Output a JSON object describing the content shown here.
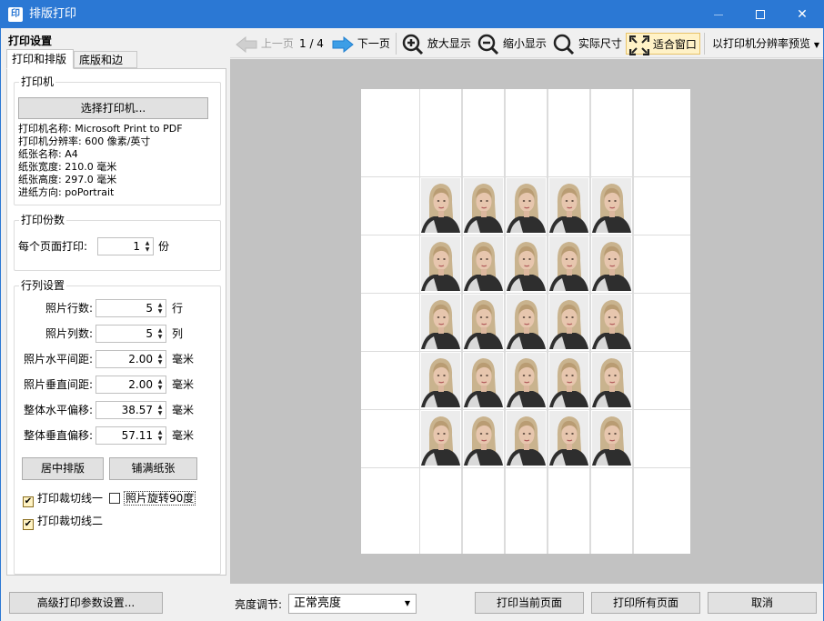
{
  "window": {
    "title": "排版打印",
    "app_icon": "印"
  },
  "left": {
    "header": "打印设置",
    "tabs": [
      {
        "label": "打印和排版"
      },
      {
        "label": "底版和边框"
      }
    ],
    "printer_group": {
      "title": "打印机",
      "select_button": "选择打印机...",
      "info": [
        "打印机名称: Microsoft Print to PDF",
        "打印机分辨率: 600 像素/英寸",
        "纸张名称: A4",
        "纸张宽度: 210.0 毫米",
        "纸张高度: 297.0 毫米",
        "进纸方向: poPortrait"
      ]
    },
    "copies_group": {
      "title": "打印份数",
      "label": "每个页面打印:",
      "value": "1",
      "unit": "份"
    },
    "layout_group": {
      "title": "行列设置",
      "fields": [
        {
          "label": "照片行数:",
          "value": "5",
          "unit": "行"
        },
        {
          "label": "照片列数:",
          "value": "5",
          "unit": "列"
        },
        {
          "label": "照片水平间距:",
          "value": "2.00",
          "unit": "毫米"
        },
        {
          "label": "照片垂直间距:",
          "value": "2.00",
          "unit": "毫米"
        },
        {
          "label": "整体水平偏移:",
          "value": "38.57",
          "unit": "毫米"
        },
        {
          "label": "整体垂直偏移:",
          "value": "57.11",
          "unit": "毫米"
        }
      ],
      "center_button": "居中排版",
      "fill_button": "铺满纸张",
      "checkbox_cutline1": {
        "label": "打印裁切线一",
        "checked": true
      },
      "checkbox_rotate": {
        "label": "照片旋转90度",
        "checked": false
      },
      "checkbox_cutline2": {
        "label": "打印裁切线二",
        "checked": true
      }
    }
  },
  "toolbar": {
    "prev": "上一页",
    "page_indicator": "1 / 4",
    "next": "下一页",
    "zoom_in": "放大显示",
    "zoom_out": "缩小显示",
    "actual_size": "实际尺寸",
    "fit_window": "适合窗口",
    "preview_mode": "以打印机分辨率预览"
  },
  "preview": {
    "rows": 5,
    "cols": 5
  },
  "bottom": {
    "advanced_button": "高级打印参数设置...",
    "brightness_label": "亮度调节:",
    "brightness_value": "正常亮度",
    "print_current": "打印当前页面",
    "print_all": "打印所有页面",
    "cancel": "取消"
  },
  "colors": {
    "titlebar": "#2b78d4",
    "preview_bg": "#c2c2c2",
    "active_tool": "#fff2c7"
  }
}
